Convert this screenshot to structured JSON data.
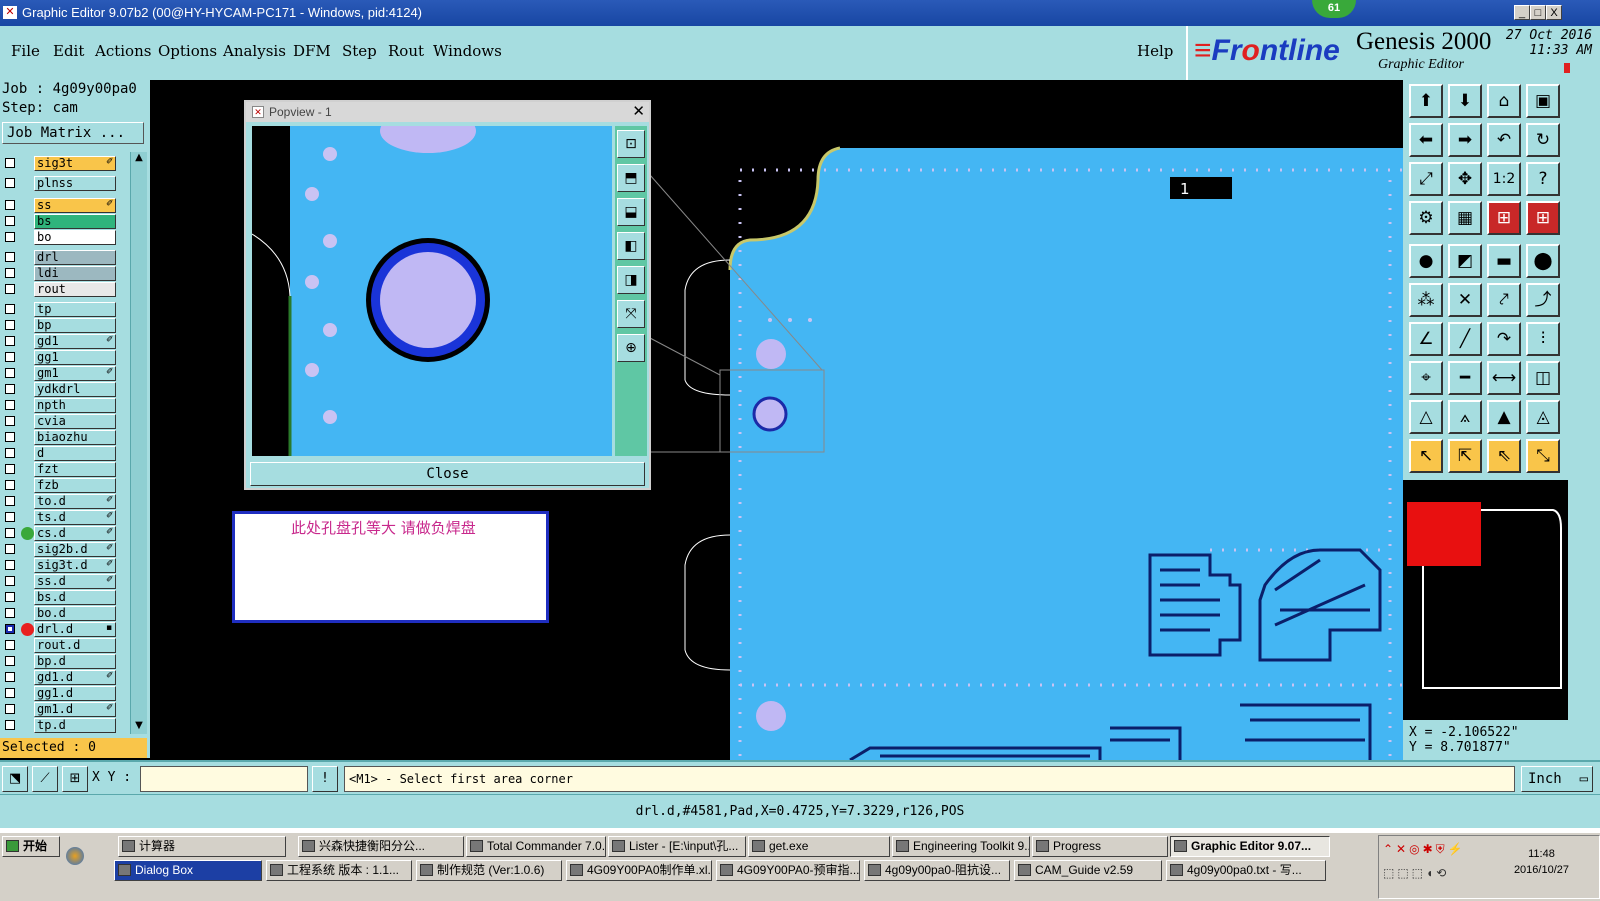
{
  "window": {
    "title": "Graphic Editor 9.07b2 (00@HY-HYCAM-PC171 - Windows, pid:4124)",
    "badge": "61",
    "min_label": "_",
    "max_label": "□",
    "close_label": "X"
  },
  "menu": {
    "items": [
      "File",
      "Edit",
      "Actions",
      "Options",
      "Analysis",
      "DFM",
      "Step",
      "Rout",
      "Windows"
    ],
    "help": "Help"
  },
  "brand": {
    "frontline_pre": "Fr",
    "frontline_o": "o",
    "frontline_post": "ntline",
    "product": "Genesis 2000",
    "subtitle": "Graphic Editor",
    "date": "27 Oct 2016",
    "time": "11:33 AM"
  },
  "left_panel": {
    "job": "Job : 4g09y00pa0",
    "step": "Step: cam",
    "job_matrix": "Job Matrix ...",
    "layers": [
      {
        "name": "sig3t",
        "color": "#f9c54a",
        "mark": "✐"
      },
      {
        "name": "plnss",
        "color": "#a6dde0",
        "mark": ""
      },
      {
        "name": "ss",
        "color": "#f9c54a",
        "mark": "✐"
      },
      {
        "name": "bs",
        "color": "#2fb47c",
        "mark": ""
      },
      {
        "name": "bo",
        "color": "#ffffff",
        "mark": ""
      },
      {
        "name": "drl",
        "color": "#9cb8c0",
        "mark": ""
      },
      {
        "name": "ldi",
        "color": "#9cb8c0",
        "mark": ""
      },
      {
        "name": "rout",
        "color": "#e8e8e8",
        "mark": ""
      },
      {
        "name": "tp",
        "color": "#a6dde0",
        "mark": ""
      },
      {
        "name": "bp",
        "color": "#a6dde0",
        "mark": ""
      },
      {
        "name": "gd1",
        "color": "#a6dde0",
        "mark": "✐"
      },
      {
        "name": "gg1",
        "color": "#a6dde0",
        "mark": ""
      },
      {
        "name": "gm1",
        "color": "#a6dde0",
        "mark": "✐"
      },
      {
        "name": "ydkdrl",
        "color": "#a6dde0",
        "mark": ""
      },
      {
        "name": "npth",
        "color": "#a6dde0",
        "mark": ""
      },
      {
        "name": "cvia",
        "color": "#a6dde0",
        "mark": ""
      },
      {
        "name": "biaozhu",
        "color": "#a6dde0",
        "mark": ""
      },
      {
        "name": "d",
        "color": "#a6dde0",
        "mark": ""
      },
      {
        "name": "fzt",
        "color": "#a6dde0",
        "mark": ""
      },
      {
        "name": "fzb",
        "color": "#a6dde0",
        "mark": ""
      },
      {
        "name": "to.d",
        "color": "#a6dde0",
        "mark": "✐"
      },
      {
        "name": "ts.d",
        "color": "#a6dde0",
        "mark": "✐"
      },
      {
        "name": "cs.d",
        "color": "#a6dde0",
        "mark": "✐",
        "dot": "#3aa83a"
      },
      {
        "name": "sig2b.d",
        "color": "#a6dde0",
        "mark": "✐"
      },
      {
        "name": "sig3t.d",
        "color": "#a6dde0",
        "mark": "✐"
      },
      {
        "name": "ss.d",
        "color": "#a6dde0",
        "mark": "✐"
      },
      {
        "name": "bs.d",
        "color": "#a6dde0",
        "mark": ""
      },
      {
        "name": "bo.d",
        "color": "#a6dde0",
        "mark": ""
      },
      {
        "name": "drl.d",
        "color": "#a6dde0",
        "mark": "▪",
        "dot": "#e82020",
        "sel": true
      },
      {
        "name": "rout.d",
        "color": "#a6dde0",
        "mark": ""
      },
      {
        "name": "bp.d",
        "color": "#a6dde0",
        "mark": ""
      },
      {
        "name": "gd1.d",
        "color": "#a6dde0",
        "mark": "✐"
      },
      {
        "name": "gg1.d",
        "color": "#a6dde0",
        "mark": ""
      },
      {
        "name": "gm1.d",
        "color": "#a6dde0",
        "mark": "✐"
      },
      {
        "name": "tp.d",
        "color": "#a6dde0",
        "mark": ""
      }
    ],
    "selected": "Selected : 0"
  },
  "popview": {
    "title": "Popview - 1",
    "close": "Close"
  },
  "note": {
    "text": "此处孔盘孔等大 请做负焊盘"
  },
  "canvas": {
    "marker_label": "1"
  },
  "coords": {
    "x": "X = -2.106522\"",
    "y": "Y = 8.701877\""
  },
  "command": {
    "xy_label": "X Y :",
    "xy_value": "",
    "bang": "!",
    "prompt": "<M1> - Select first area corner",
    "unit": "Inch"
  },
  "info": "drl.d,#4581,Pad,X=0.4725,Y=7.3229,r126,POS",
  "taskbar": {
    "start": "开始",
    "row1": [
      "计算器",
      "兴森快捷衡阳分公...",
      "Total Commander 7.0...",
      "Lister - [E:\\input\\孔...",
      "get.exe",
      "Engineering Toolkit 9....",
      "Progress",
      "Graphic Editor 9.07..."
    ],
    "row2": [
      "Dialog Box",
      "工程系统  版本 : 1.1...",
      "制作规范 (Ver:1.0.6)",
      "4G09Y00PA0制作单.xl...",
      "4G09Y00PA0-预审指...",
      "4g09y00pa0-阻抗设...",
      "CAM_Guide v2.59",
      "4g09y00pa0.txt - 写..."
    ],
    "clock_time": "11:48",
    "clock_date": "2016/10/27"
  }
}
